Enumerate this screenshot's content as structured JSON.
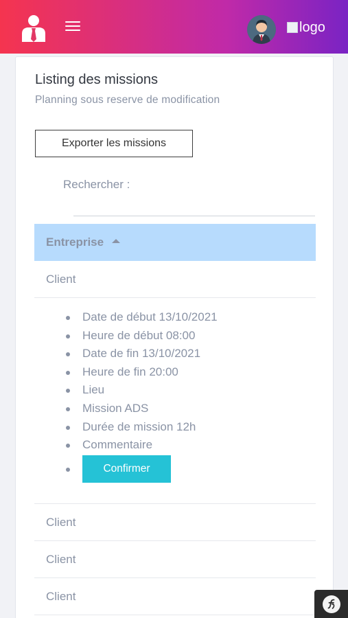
{
  "header": {
    "menu_icon": "hamburger-icon",
    "brand_icon": "user-tie-icon",
    "logo_alt": "logo"
  },
  "page": {
    "title": "Listing des missions",
    "subtitle": "Planning sous reserve de modification",
    "export_label": "Exporter les missions",
    "search_label": "Rechercher :",
    "search_value": ""
  },
  "table": {
    "column_header": "Entreprise",
    "rows": [
      "Client",
      "Client",
      "Client",
      "Client"
    ],
    "expanded_details": [
      "Date de début 13/10/2021",
      "Heure de début 08:00",
      "Date de fin 13/10/2021",
      "Heure de fin 20:00",
      "Lieu",
      "Mission ADS",
      "Durée de mission 12h",
      "Commentaire"
    ],
    "confirm_label": "Confirmer"
  },
  "colors": {
    "header_gradient_start": "#f5344f",
    "header_gradient_end": "#7a23c4",
    "table_header_bg": "#b7dbfd",
    "confirm_bg": "#25c2d6"
  }
}
